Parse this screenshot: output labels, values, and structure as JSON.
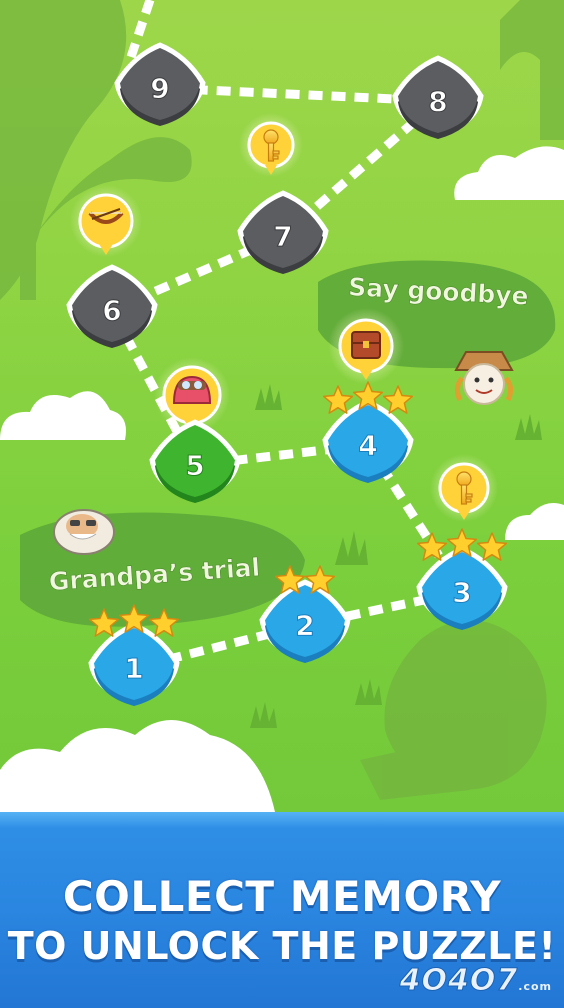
{
  "banner": {
    "line1": "COLLECT MEMORY",
    "line2": "TO UNLOCK THE PUZZLE!",
    "watermark": "4O4O7",
    "watermark_suffix": ".com"
  },
  "chapters": [
    {
      "title": "Grandpa’s trial",
      "character": "grandpa-icon"
    },
    {
      "title": "Say goodbye",
      "character": "scarecrow-icon"
    }
  ],
  "levels": [
    {
      "number": "1",
      "state": "completed",
      "stars": 3
    },
    {
      "number": "2",
      "state": "completed",
      "stars": 2
    },
    {
      "number": "3",
      "state": "completed",
      "stars": 3
    },
    {
      "number": "4",
      "state": "completed",
      "stars": 3
    },
    {
      "number": "5",
      "state": "current",
      "stars": 0
    },
    {
      "number": "6",
      "state": "locked",
      "stars": 0
    },
    {
      "number": "7",
      "state": "locked",
      "stars": 0
    },
    {
      "number": "8",
      "state": "locked",
      "stars": 0
    },
    {
      "number": "9",
      "state": "locked",
      "stars": 0
    }
  ],
  "rewards": [
    "key-icon",
    "treasure-chest-icon",
    "aviator-helmet-icon",
    "bow-icon",
    "key-icon"
  ],
  "colors": {
    "completed": "#2aa7e6",
    "current": "#3fb52f",
    "locked": "#5b5d60",
    "star": "#ffcf2e",
    "banner": "#2a86e0"
  }
}
